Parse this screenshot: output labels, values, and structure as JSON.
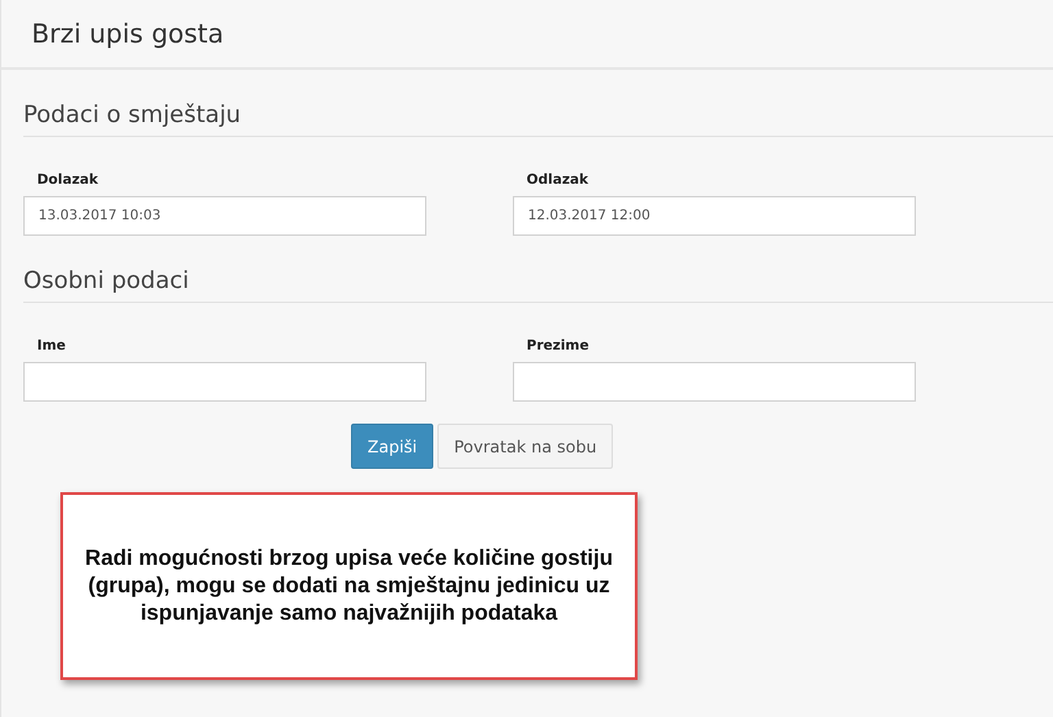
{
  "page_title": "Brzi upis gosta",
  "sections": [
    {
      "heading": "Podaci o smještaju",
      "fields": [
        {
          "label": "Dolazak",
          "value": "13.03.2017 10:03"
        },
        {
          "label": "Odlazak",
          "value": "12.03.2017 12:00"
        }
      ]
    },
    {
      "heading": "Osobni podaci",
      "fields": [
        {
          "label": "Ime"
        },
        {
          "label": "Prezime"
        }
      ]
    }
  ],
  "buttons": [
    {
      "label": "Zapiši",
      "kind": "primary"
    },
    {
      "label": "Povratak na sobu",
      "kind": "default"
    }
  ],
  "callout": {
    "text": "Radi mogućnosti brzog upisa veće količine gostiju (grupa), mogu se dodati na smještajnu jedinicu uz ispunjavanje samo najvažnijih podataka"
  }
}
